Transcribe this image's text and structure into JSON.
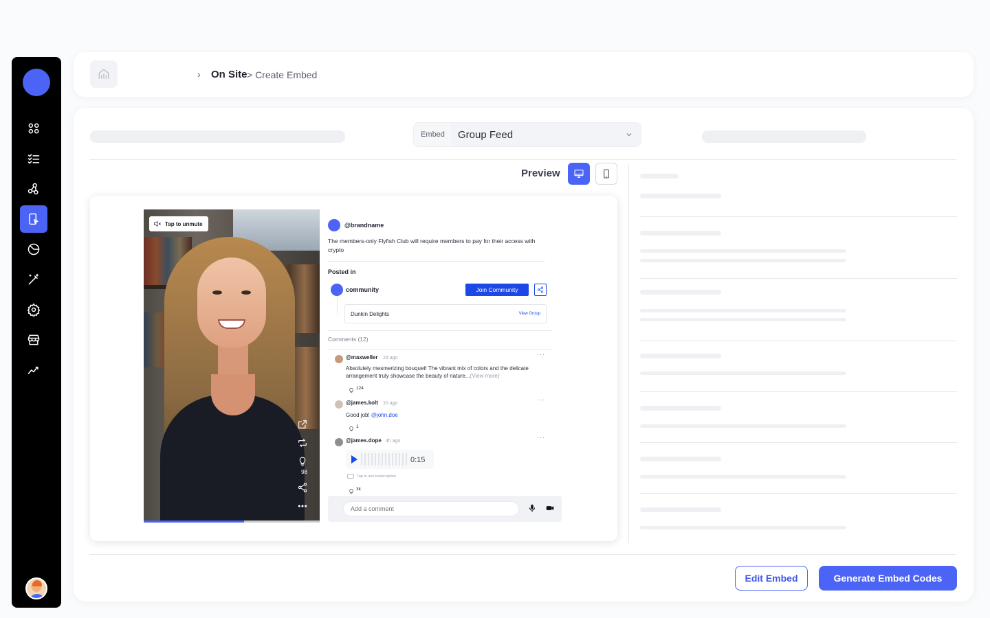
{
  "breadcrumb": {
    "separator": "›",
    "main": "On Site",
    "sub": "> Create Embed"
  },
  "embed": {
    "label": "Embed",
    "value": "Group Feed"
  },
  "preview": {
    "label": "Preview"
  },
  "video": {
    "unmute_label": "Tap to unmute",
    "like_count": "98",
    "progress": 0.57
  },
  "post": {
    "handle": "@brandname",
    "text": "The members-only Flyfish Club will require members to pay for their access with crypto",
    "posted_in_label": "Posted in",
    "community_name": "community",
    "join_label": "Join Community",
    "group_name": "Dunkin Delights",
    "view_group_label": "View Group",
    "comments_label": "Comments (12)"
  },
  "comments": [
    {
      "handle": "@maxweller",
      "time": "2d ago",
      "text": "Absolutely mesmerizing bouquet! The vibrant mix of colors and the delicate arrangement truly showcase the beauty of nature...",
      "more": "(View more)",
      "likes": "124"
    },
    {
      "handle": "@james.kolt",
      "time": "1h ago",
      "text_prefix": "Good job! ",
      "mention": "@john.doe",
      "likes": "1"
    },
    {
      "handle": "@james.dope",
      "time": "4h ago",
      "audio_time": "0:15",
      "transcription_hint": "Tap to see transcription",
      "likes": "3k"
    }
  ],
  "comment_box": {
    "placeholder": "Add a comment"
  },
  "actions": {
    "edit_label": "Edit Embed",
    "generate_label": "Generate Embed Codes"
  },
  "colors": {
    "accent": "#4b64f5",
    "link": "#1b48e6"
  }
}
